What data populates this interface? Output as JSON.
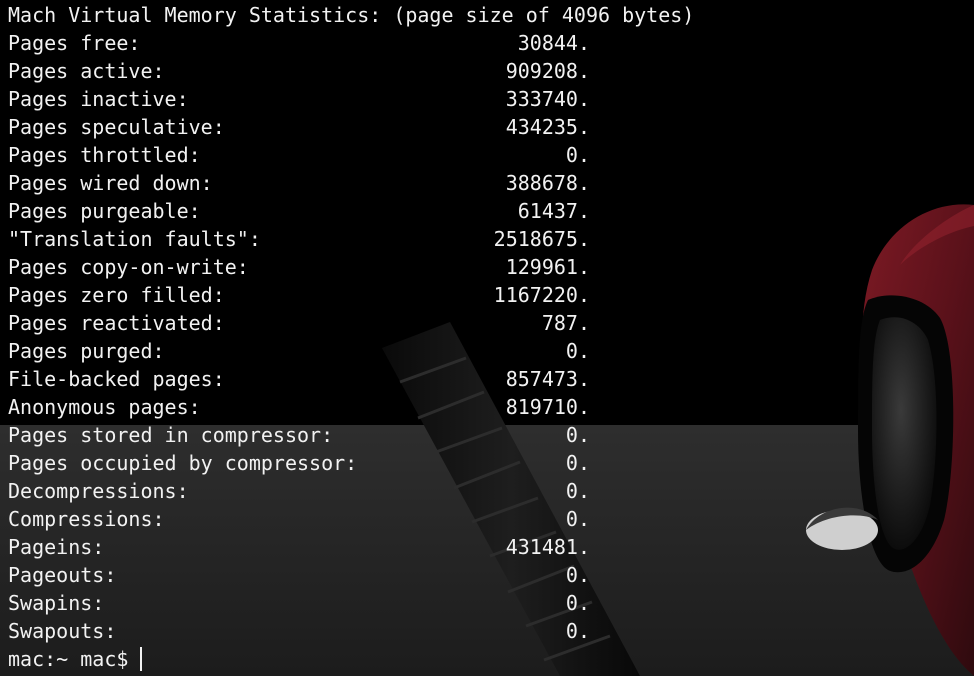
{
  "terminal": {
    "header": "Mach Virtual Memory Statistics: (page size of 4096 bytes)",
    "stats": [
      {
        "label": "Pages free:",
        "value": "30844."
      },
      {
        "label": "Pages active:",
        "value": "909208."
      },
      {
        "label": "Pages inactive:",
        "value": "333740."
      },
      {
        "label": "Pages speculative:",
        "value": "434235."
      },
      {
        "label": "Pages throttled:",
        "value": "0."
      },
      {
        "label": "Pages wired down:",
        "value": "388678."
      },
      {
        "label": "Pages purgeable:",
        "value": "61437."
      },
      {
        "label": "\"Translation faults\":",
        "value": "2518675."
      },
      {
        "label": "Pages copy-on-write:",
        "value": "129961."
      },
      {
        "label": "Pages zero filled:",
        "value": "1167220."
      },
      {
        "label": "Pages reactivated:",
        "value": "787."
      },
      {
        "label": "Pages purged:",
        "value": "0."
      },
      {
        "label": "File-backed pages:",
        "value": "857473."
      },
      {
        "label": "Anonymous pages:",
        "value": "819710."
      },
      {
        "label": "Pages stored in compressor:",
        "value": "0."
      },
      {
        "label": "Pages occupied by compressor:",
        "value": "0."
      },
      {
        "label": "Decompressions:",
        "value": "0."
      },
      {
        "label": "Compressions:",
        "value": "0."
      },
      {
        "label": "Pageins:",
        "value": "431481."
      },
      {
        "label": "Pageouts:",
        "value": "0."
      },
      {
        "label": "Swapins:",
        "value": "0."
      },
      {
        "label": "Swapouts:",
        "value": "0."
      }
    ],
    "prompt": "mac:~ mac$"
  },
  "colors": {
    "background": "#000000",
    "text": "#f2f2f2",
    "mask_red": "#6e1620"
  }
}
